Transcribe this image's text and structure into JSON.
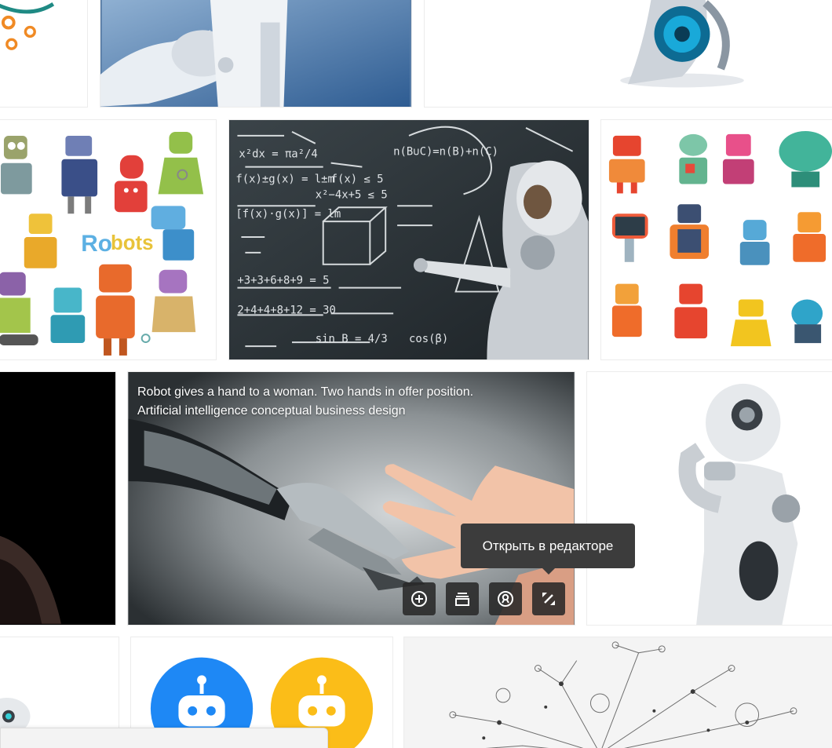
{
  "gallery": {
    "hovered_item": {
      "caption_line1": "Robot gives a hand to a woman. Two hands in offer position.",
      "caption_line2": "Artificial intelligence conceptual business design"
    },
    "actions": [
      {
        "name": "add",
        "icon": "plus-circle-icon"
      },
      {
        "name": "collection",
        "icon": "stack-icon"
      },
      {
        "name": "author",
        "icon": "profile-icon"
      },
      {
        "name": "edit",
        "icon": "edit-icon"
      }
    ],
    "tooltip": "Открыть в редакторе"
  },
  "colors": {
    "action_button_bg": "#282828",
    "tooltip_bg": "#3c3c3c",
    "robot_blue": "#1e88f5",
    "robot_yellow": "#fbbd18"
  }
}
